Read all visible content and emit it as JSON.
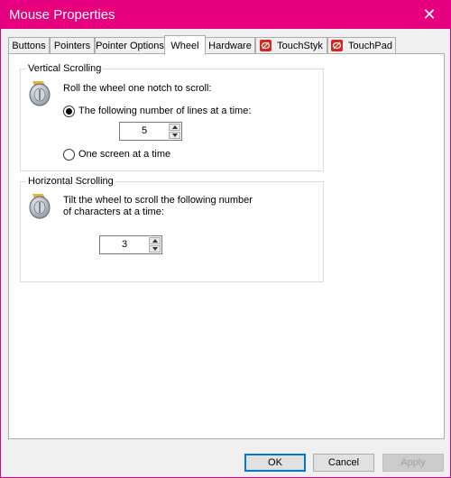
{
  "window": {
    "title": "Mouse Properties",
    "close_glyph": "✕"
  },
  "tabs": [
    {
      "label": "Buttons",
      "active": false
    },
    {
      "label": "Pointers",
      "active": false
    },
    {
      "label": "Pointer Options",
      "active": false
    },
    {
      "label": "Wheel",
      "active": true
    },
    {
      "label": "Hardware",
      "active": false
    },
    {
      "label": "TouchStyk",
      "active": false,
      "icon": "touchstyk-icon"
    },
    {
      "label": "TouchPad",
      "active": false,
      "icon": "touchpad-icon"
    }
  ],
  "vertical": {
    "legend": "Vertical Scrolling",
    "instruction": "Roll the wheel one notch to scroll:",
    "option_lines": "The following number of lines at a time:",
    "lines_value": "5",
    "option_screen": "One screen at a time",
    "selected": "lines"
  },
  "horizontal": {
    "legend": "Horizontal Scrolling",
    "instruction_line1": "Tilt the wheel to scroll the following number",
    "instruction_line2": "of characters at a time:",
    "chars_value": "3"
  },
  "buttons": {
    "ok": "OK",
    "cancel": "Cancel",
    "apply": "Apply"
  },
  "colors": {
    "titlebar": "#e6007e",
    "default_button_border": "#0078d7",
    "brand_icon_red": "#d9261c"
  }
}
